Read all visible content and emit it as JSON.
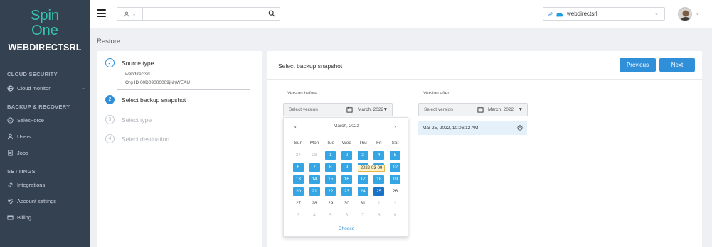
{
  "sidebar": {
    "logo": {
      "line1": "Spin",
      "line2": "One",
      "org": "WEBDIRECTSRL"
    },
    "sections": [
      {
        "title": "CLOUD SECURITY",
        "items": [
          {
            "label": "Cloud monitor",
            "icon": "globe-icon"
          }
        ]
      },
      {
        "title": "BACKUP & RECOVERY",
        "items": [
          {
            "label": "SalesForce",
            "icon": "check-circle-icon"
          },
          {
            "label": "Users",
            "icon": "user-icon"
          },
          {
            "label": "Jobs",
            "icon": "file-icon"
          }
        ]
      },
      {
        "title": "SETTINGS",
        "items": [
          {
            "label": "Integrations",
            "icon": "link-icon"
          },
          {
            "label": "Account settings",
            "icon": "gear-icon"
          },
          {
            "label": "Billing",
            "icon": "card-icon"
          }
        ]
      }
    ]
  },
  "header": {
    "search_placeholder": "",
    "org_selector": "webdirectsrl"
  },
  "page_title": "Restore",
  "steps": [
    {
      "number": "1",
      "label": "Source type",
      "status": "done"
    },
    {
      "number": "2",
      "label": "Select backup snapshot",
      "status": "active"
    },
    {
      "number": "3",
      "label": "Select type",
      "status": "todo"
    },
    {
      "number": "4",
      "label": "Select destination",
      "status": "todo"
    }
  ],
  "source_detail": {
    "name": "webdirectsrl",
    "org_id": "Org ID 00D09000009jNhWEAU"
  },
  "main": {
    "title": "Select backup snapshot",
    "previous_label": "Previous",
    "next_label": "Next",
    "before": {
      "label": "Version before",
      "placeholder": "Select version",
      "month": "March, 2022"
    },
    "after": {
      "label": "Version after",
      "placeholder": "Select version",
      "month": "March, 2022",
      "item": "Mar 25, 2022, 10:06:12 AM"
    }
  },
  "calendar": {
    "month": "March, 2022",
    "weekdays": [
      "Sun",
      "Mon",
      "Tue",
      "Wed",
      "Thu",
      "Fri",
      "Sat"
    ],
    "weeks": [
      [
        {
          "d": "27",
          "s": "other"
        },
        {
          "d": "28",
          "s": "other"
        },
        {
          "d": "1",
          "s": "av"
        },
        {
          "d": "2",
          "s": "av"
        },
        {
          "d": "3",
          "s": "av"
        },
        {
          "d": "4",
          "s": "av"
        },
        {
          "d": "5",
          "s": "av"
        }
      ],
      [
        {
          "d": "6",
          "s": "av"
        },
        {
          "d": "7",
          "s": "av"
        },
        {
          "d": "8",
          "s": "av"
        },
        {
          "d": "9",
          "s": "av"
        },
        {
          "d": "10",
          "s": "av"
        },
        {
          "d": "11",
          "s": "av"
        },
        {
          "d": "12",
          "s": "av"
        }
      ],
      [
        {
          "d": "13",
          "s": "av"
        },
        {
          "d": "14",
          "s": "av"
        },
        {
          "d": "15",
          "s": "av"
        },
        {
          "d": "16",
          "s": "av"
        },
        {
          "d": "17",
          "s": "av"
        },
        {
          "d": "18",
          "s": "av"
        },
        {
          "d": "19",
          "s": "av"
        }
      ],
      [
        {
          "d": "20",
          "s": "av"
        },
        {
          "d": "21",
          "s": "av"
        },
        {
          "d": "22",
          "s": "av"
        },
        {
          "d": "23",
          "s": "av"
        },
        {
          "d": "24",
          "s": "av"
        },
        {
          "d": "25",
          "s": "sel"
        },
        {
          "d": "26",
          "s": "normal"
        }
      ],
      [
        {
          "d": "27",
          "s": "normal"
        },
        {
          "d": "28",
          "s": "normal"
        },
        {
          "d": "29",
          "s": "normal"
        },
        {
          "d": "30",
          "s": "normal"
        },
        {
          "d": "31",
          "s": "normal"
        },
        {
          "d": "1",
          "s": "other"
        },
        {
          "d": "2",
          "s": "other"
        }
      ],
      [
        {
          "d": "3",
          "s": "other"
        },
        {
          "d": "4",
          "s": "other"
        },
        {
          "d": "5",
          "s": "other"
        },
        {
          "d": "6",
          "s": "other"
        },
        {
          "d": "7",
          "s": "other"
        },
        {
          "d": "8",
          "s": "other"
        },
        {
          "d": "9",
          "s": "other"
        }
      ]
    ],
    "tooltip": "2022-03-09",
    "choose_label": "Choose"
  },
  "colors": {
    "accent": "#2f8fd8",
    "sidebar": "#344151",
    "logo": "#35c4b0"
  }
}
